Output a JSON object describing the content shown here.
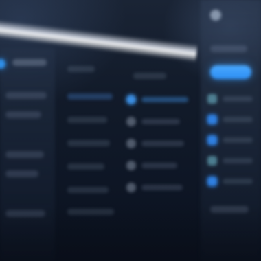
{
  "colors": {
    "accent": "#2f8fe8",
    "background": "#0b1220",
    "primary_button": "#3aa0ff"
  },
  "icons": {
    "sidebar_active": "circle-icon",
    "list_item": "circle-icon",
    "user": "avatar-icon"
  }
}
